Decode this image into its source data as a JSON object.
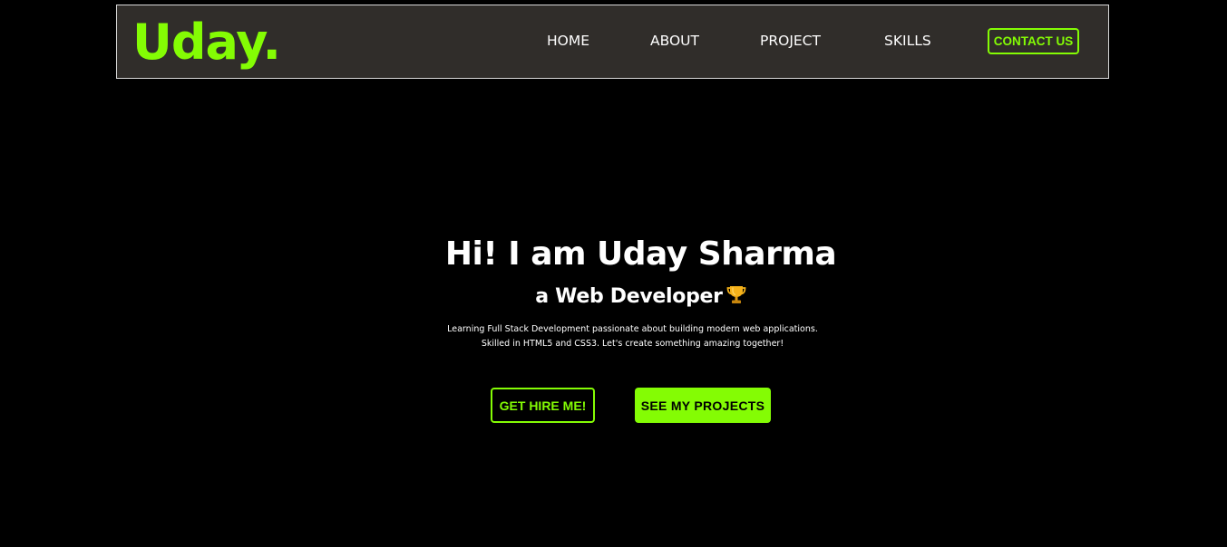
{
  "brand": {
    "logo_text": "Uday.",
    "accent_color": "#84fc04"
  },
  "nav": {
    "items": [
      {
        "label": "HOME"
      },
      {
        "label": "ABOUT"
      },
      {
        "label": "PROJECT"
      },
      {
        "label": "SKILLS"
      }
    ],
    "contact_label": "CONTACT US"
  },
  "hero": {
    "title": "Hi! I am Uday Sharma",
    "subtitle": "a Web Developer",
    "subtitle_icon": "trophy-icon",
    "description_line1": "Learning Full Stack Development passionate about building modern web applications.",
    "description_line2": "Skilled in HTML5 and CSS3. Let's create something amazing together!",
    "hire_label": "GET HIRE ME!",
    "projects_label": "SEE MY PROJECTS"
  },
  "colors": {
    "background": "#000000",
    "navbar": "#302d2a",
    "text": "#ffffff"
  }
}
